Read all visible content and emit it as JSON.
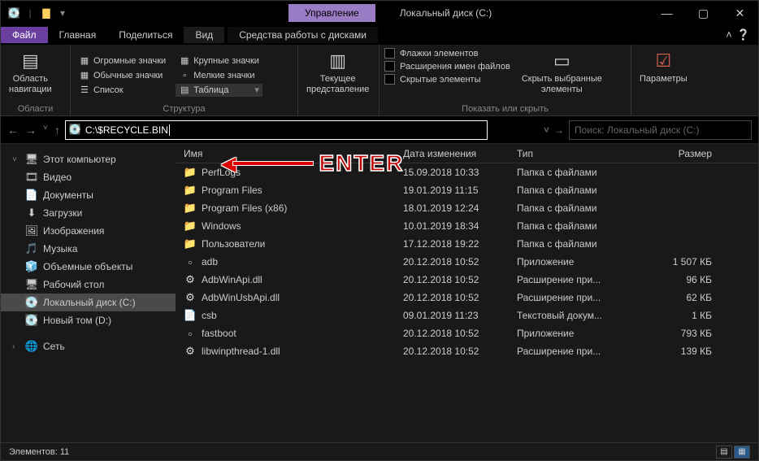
{
  "title": "Локальный диск (C:)",
  "titlebar_context": "Управление",
  "tabs": {
    "file": "Файл",
    "main": "Главная",
    "share": "Поделиться",
    "view": "Вид",
    "drives": "Средства работы с дисками"
  },
  "ribbon": {
    "panes": {
      "nav": {
        "btn": "Область\nнавигации",
        "label": "Области"
      },
      "layout": {
        "huge": "Огромные значки",
        "large": "Крупные значки",
        "normal": "Обычные значки",
        "small": "Мелкие значки",
        "list": "Список",
        "table": "Таблица",
        "label": "Структура"
      },
      "current": {
        "btn": "Текущее\nпредставление",
        "label": ""
      },
      "show": {
        "flags": "Флажки элементов",
        "ext": "Расширения имен файлов",
        "hidden": "Скрытые элементы",
        "hide_btn": "Скрыть выбранные\nэлементы",
        "label": "Показать или скрыть"
      },
      "options": {
        "btn": "Параметры"
      }
    }
  },
  "address": "C:\\$RECYCLE.BIN",
  "search_placeholder": "Поиск: Локальный диск (C:)",
  "sidebar": {
    "this_pc": "Этот компьютер",
    "items": [
      {
        "icon": "🎞",
        "label": "Видео"
      },
      {
        "icon": "📄",
        "label": "Документы"
      },
      {
        "icon": "⬇",
        "label": "Загрузки"
      },
      {
        "icon": "🖼",
        "label": "Изображения"
      },
      {
        "icon": "🎵",
        "label": "Музыка",
        "color": "#4fc3f7"
      },
      {
        "icon": "🧊",
        "label": "Объемные объекты"
      },
      {
        "icon": "🖥",
        "label": "Рабочий стол"
      },
      {
        "icon": "💽",
        "label": "Локальный диск (C:)",
        "sel": true
      },
      {
        "icon": "💽",
        "label": "Новый том (D:)"
      }
    ],
    "network": "Сеть"
  },
  "columns": {
    "name": "Имя",
    "date": "Дата изменения",
    "type": "Тип",
    "size": "Размер"
  },
  "files": [
    {
      "i": "📁",
      "f": true,
      "name": "PerfLogs",
      "date": "15.09.2018 10:33",
      "type": "Папка с файлами",
      "size": ""
    },
    {
      "i": "📁",
      "f": true,
      "name": "Program Files",
      "date": "19.01.2019 11:15",
      "type": "Папка с файлами",
      "size": ""
    },
    {
      "i": "📁",
      "f": true,
      "name": "Program Files (x86)",
      "date": "18.01.2019 12:24",
      "type": "Папка с файлами",
      "size": ""
    },
    {
      "i": "📁",
      "f": true,
      "name": "Windows",
      "date": "10.01.2019 18:34",
      "type": "Папка с файлами",
      "size": ""
    },
    {
      "i": "📁",
      "f": true,
      "name": "Пользователи",
      "date": "17.12.2018 19:22",
      "type": "Папка с файлами",
      "size": ""
    },
    {
      "i": "▫",
      "f": false,
      "name": "adb",
      "date": "20.12.2018 10:52",
      "type": "Приложение",
      "size": "1 507 КБ"
    },
    {
      "i": "⚙",
      "f": false,
      "name": "AdbWinApi.dll",
      "date": "20.12.2018 10:52",
      "type": "Расширение при...",
      "size": "96 КБ"
    },
    {
      "i": "⚙",
      "f": false,
      "name": "AdbWinUsbApi.dll",
      "date": "20.12.2018 10:52",
      "type": "Расширение при...",
      "size": "62 КБ"
    },
    {
      "i": "📄",
      "f": false,
      "name": "csb",
      "date": "09.01.2019 11:23",
      "type": "Текстовый докум...",
      "size": "1 КБ"
    },
    {
      "i": "▫",
      "f": false,
      "name": "fastboot",
      "date": "20.12.2018 10:52",
      "type": "Приложение",
      "size": "793 КБ"
    },
    {
      "i": "⚙",
      "f": false,
      "name": "libwinpthread-1.dll",
      "date": "20.12.2018 10:52",
      "type": "Расширение при...",
      "size": "139 КБ"
    }
  ],
  "status": "Элементов: 11",
  "overlay": "ENTER"
}
